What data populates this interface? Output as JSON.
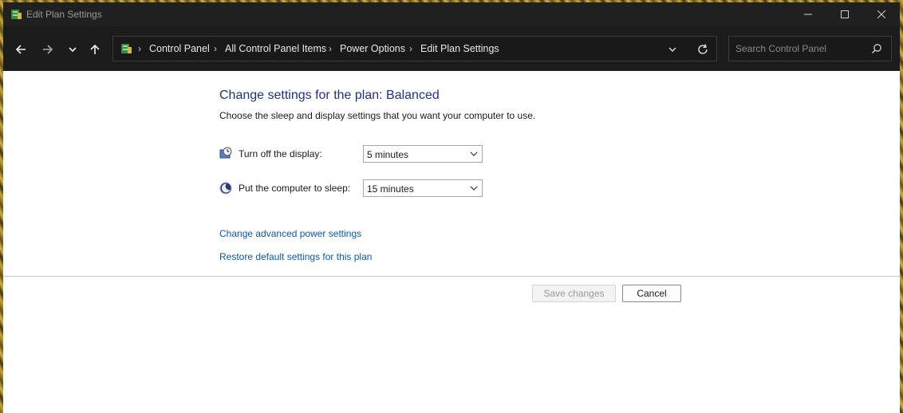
{
  "window": {
    "title": "Edit Plan Settings"
  },
  "breadcrumb": {
    "items": [
      "Control Panel",
      "All Control Panel Items",
      "Power Options",
      "Edit Plan Settings"
    ]
  },
  "search": {
    "placeholder": "Search Control Panel"
  },
  "main": {
    "heading": "Change settings for the plan: Balanced",
    "description": "Choose the sleep and display settings that you want your computer to use.",
    "settings": [
      {
        "label": "Turn off the display:",
        "value": "5 minutes",
        "icon": "display-timer-icon"
      },
      {
        "label": "Put the computer to sleep:",
        "value": "15 minutes",
        "icon": "sleep-moon-icon"
      }
    ],
    "links": {
      "advanced": "Change advanced power settings",
      "restore": "Restore default settings for this plan"
    },
    "buttons": {
      "save": "Save changes",
      "cancel": "Cancel"
    }
  },
  "colors": {
    "heading": "#1e3287",
    "link": "#0a58b5",
    "titlebar": "#202020"
  }
}
